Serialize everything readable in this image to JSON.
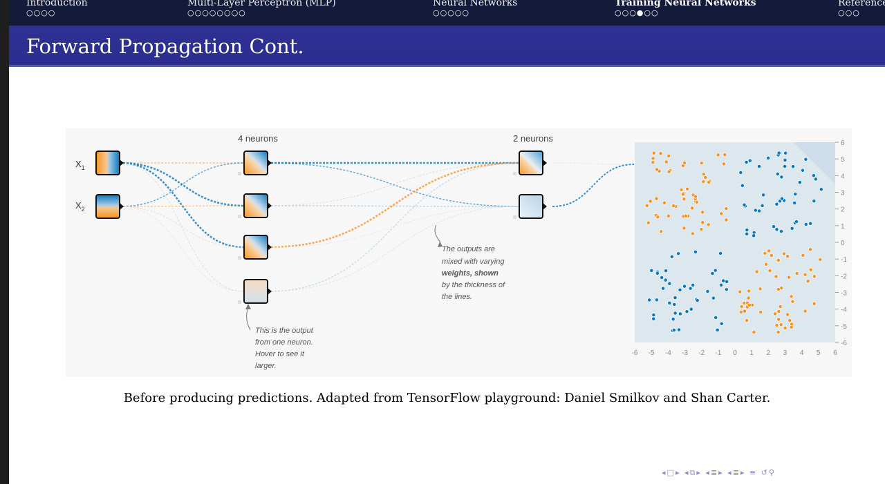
{
  "navbar": {
    "sections": [
      {
        "title": "Introduction",
        "dots": "○○○○",
        "active": false
      },
      {
        "title": "Multi-Layer Perceptron (MLP)",
        "dots": "○○○○○○○○",
        "active": false
      },
      {
        "title": "Neural Networks",
        "dots": "○○○○○",
        "active": false
      },
      {
        "title": "Training Neural Networks",
        "dots": "○○○●○○",
        "active": true
      },
      {
        "title": "References",
        "dots": "○○○",
        "active": false
      }
    ]
  },
  "slide": {
    "title": "Forward Propagation Cont.",
    "caption": "Before producing predictions. Adapted from TensorFlow playground: Daniel Smilkov and Shan Carter."
  },
  "figure": {
    "inputs": [
      "X1",
      "X2"
    ],
    "layer1_label": "4 neurons",
    "layer2_label": "2 neurons",
    "annotation_weights": [
      "The outputs are",
      "mixed with varying",
      "weights, shown",
      "by the thickness of",
      "the lines."
    ],
    "annotation_neuron": [
      "This is the output",
      "from one neuron.",
      "Hover to see it",
      "larger."
    ],
    "x_ticks": [
      "-6",
      "-5",
      "-4",
      "-3",
      "-2",
      "-1",
      "0",
      "1",
      "2",
      "3",
      "4",
      "5",
      "6"
    ],
    "y_ticks": [
      "6",
      "5",
      "4",
      "3",
      "2",
      "1",
      "0",
      "-1",
      "-2",
      "-3",
      "-4",
      "-5",
      "-6"
    ],
    "colors": {
      "orange": "#f59322",
      "blue": "#0877bd",
      "bg": "#dde7ee"
    }
  },
  "bottom_nav": {
    "icons": [
      "frame-prev-icon",
      "frame-next-icon",
      "subsection-prev-icon",
      "subsection-next-icon",
      "section-prev-icon",
      "section-next-icon",
      "toc-icon",
      "search-icon"
    ]
  }
}
